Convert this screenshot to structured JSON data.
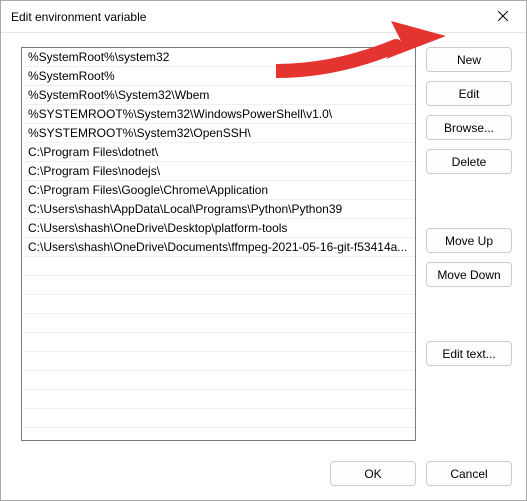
{
  "title": "Edit environment variable",
  "list": [
    "%SystemRoot%\\system32",
    "%SystemRoot%",
    "%SystemRoot%\\System32\\Wbem",
    "%SYSTEMROOT%\\System32\\WindowsPowerShell\\v1.0\\",
    "%SYSTEMROOT%\\System32\\OpenSSH\\",
    "C:\\Program Files\\dotnet\\",
    "C:\\Program Files\\nodejs\\",
    "C:\\Program Files\\Google\\Chrome\\Application",
    "C:\\Users\\shash\\AppData\\Local\\Programs\\Python\\Python39",
    "C:\\Users\\shash\\OneDrive\\Desktop\\platform-tools",
    "C:\\Users\\shash\\OneDrive\\Documents\\ffmpeg-2021-05-16-git-f53414a..."
  ],
  "buttons": {
    "new": "New",
    "edit": "Edit",
    "browse": "Browse...",
    "delete": "Delete",
    "moveUp": "Move Up",
    "moveDown": "Move Down",
    "editText": "Edit text...",
    "ok": "OK",
    "cancel": "Cancel"
  },
  "annotation": {
    "arrow_color": "#e3342f",
    "arrow_target": "new-button"
  }
}
